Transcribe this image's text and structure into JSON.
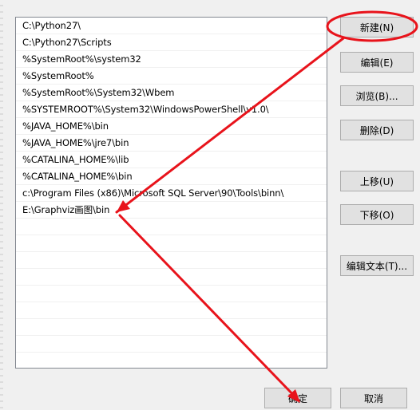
{
  "path_list": {
    "items": [
      "C:\\Python27\\",
      "C:\\Python27\\Scripts",
      "%SystemRoot%\\system32",
      "%SystemRoot%",
      "%SystemRoot%\\System32\\Wbem",
      "%SYSTEMROOT%\\System32\\WindowsPowerShell\\v1.0\\",
      "%JAVA_HOME%\\bin",
      "%JAVA_HOME%\\jre7\\bin",
      "%CATALINA_HOME%\\lib",
      "%CATALINA_HOME%\\bin",
      "c:\\Program Files (x86)\\Microsoft SQL Server\\90\\Tools\\binn\\",
      "E:\\Graphviz画图\\bin"
    ]
  },
  "buttons": {
    "new": "新建(N)",
    "edit": "编辑(E)",
    "browse": "浏览(B)...",
    "delete": "删除(D)",
    "move_up": "上移(U)",
    "move_down": "下移(O)",
    "edit_text": "编辑文本(T)...",
    "ok": "确定",
    "cancel": "取消"
  },
  "colors": {
    "annotation": "#e8131b"
  }
}
